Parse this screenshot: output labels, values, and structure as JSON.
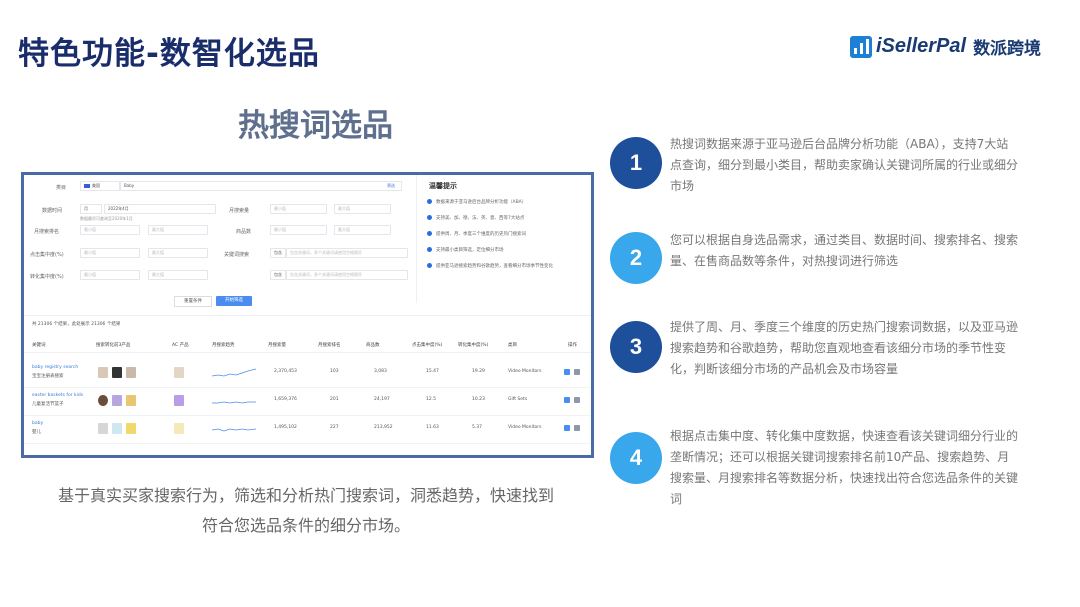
{
  "header": {
    "title": "特色功能-数智化选品",
    "logo_en": "iSellerPal",
    "logo_cn": "数派跨境"
  },
  "section": {
    "heading": "热搜词选品",
    "caption_line1": "基于真实买家搜索行为，筛选和分析热门搜索词，洞悉趋势，快速找到",
    "caption_line2": "符合您选品条件的细分市场。"
  },
  "screenshot": {
    "filters": {
      "market_label": "类目",
      "market_value": "美国",
      "keyword_value": "Baby",
      "search_btn": "筛选",
      "data_time_label": "数据时间",
      "period": "月",
      "date": "2022年4月",
      "date_hint": "数据最早可查询至2020年1月",
      "monthly_search_label": "月搜索量",
      "monthly_rank_label": "月搜索排名",
      "product_count_label": "商品数",
      "click_conc_label": "点击集中度(%)",
      "keyword_search_label": "关键词搜索",
      "conv_conc_label": "转化集中度(%)",
      "placeholder_min": "最小值",
      "placeholder_max": "最大值",
      "placeholder_keyword": "包含关键词，多个关键词请使用空格隔开",
      "contain_label": "包含"
    },
    "tips": {
      "title": "温馨提示",
      "items": [
        "数据来源于亚马逊后台品牌分析功能（ABA）",
        "支持美、加、德、法、英、意、西等7大站点",
        "提供周、月、季度三个维度的历史热门搜索词",
        "支持最小类目筛选，定位细分市场",
        "提供亚马逊搜索趋势和谷歌趋势，查看细分市场季节性变化"
      ]
    },
    "buttons": {
      "reset": "重置条件",
      "start": "开始筛选"
    },
    "result_count": "共 21306 个结果，此处展示 21306 个结果",
    "columns": [
      "关键词",
      "搜索转化前3产品",
      "AC 产品",
      "月搜索趋势",
      "月搜索量",
      "月搜索排名",
      "商品数",
      "点击集中度(%)",
      "转化集中度(%)",
      "类目",
      "操作"
    ],
    "rows": [
      {
        "kw": "baby registry search",
        "kw_cn": "宝宝注册表搜索",
        "volume": "2,370,453",
        "rank": "103",
        "products": "3,083",
        "click": "15.47",
        "conv": "19.29",
        "category": "Video Monitors"
      },
      {
        "kw": "easter baskets for kids",
        "kw_cn": "儿童复活节篮子",
        "volume": "1,659,376",
        "rank": "201",
        "products": "24,197",
        "click": "12.5",
        "conv": "10.23",
        "category": "Gift Sets"
      },
      {
        "kw": "baby",
        "kw_cn": "婴儿",
        "volume": "1,495,102",
        "rank": "227",
        "products": "213,952",
        "click": "11.63",
        "conv": "5.37",
        "category": "Video Monitors"
      }
    ]
  },
  "features": [
    {
      "num": "1",
      "text": "热搜词数据来源于亚马逊后台品牌分析功能（ABA），支持7大站点查询，细分到最小类目，帮助卖家确认关键词所属的行业或细分市场",
      "color": "#1d4f9b"
    },
    {
      "num": "2",
      "text": "您可以根据自身选品需求，通过类目、数据时间、搜索排名、搜索量、在售商品数等条件，对热搜词进行筛选",
      "color": "#38a7eb"
    },
    {
      "num": "3",
      "text": "提供了周、月、季度三个维度的历史热门搜索词数据，以及亚马逊搜索趋势和谷歌趋势，帮助您直观地查看该细分市场的季节性变化，判断该细分市场的产品机会及市场容量",
      "color": "#1d4f9b"
    },
    {
      "num": "4",
      "text": "根据点击集中度、转化集中度数据，快速查看该关键词细分行业的垄断情况；还可以根据关键词搜索排名前10产品、搜索趋势、月搜索量、月搜索排名等数据分析，快速找出符合您选品条件的关键词",
      "color": "#38a7eb"
    }
  ]
}
